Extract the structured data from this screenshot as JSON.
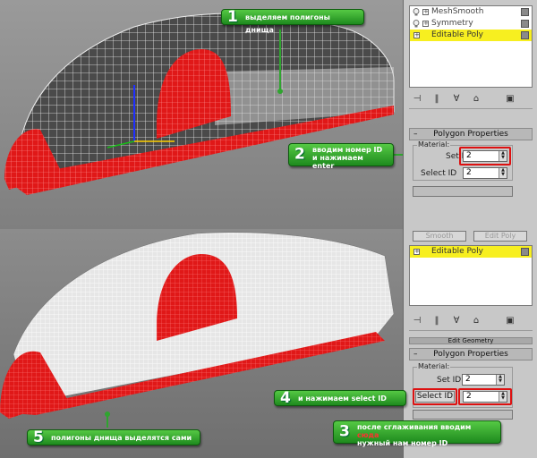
{
  "top": {
    "stack": [
      {
        "label": "MeshSmooth",
        "selected": false
      },
      {
        "label": "Symmetry",
        "selected": false
      },
      {
        "label": "Editable Poly",
        "selected": true
      }
    ],
    "rollout_title": "Polygon Properties",
    "group_label": "Material:",
    "set_id_label": "Set ID:",
    "set_id_value": "2",
    "select_id_label": "Select ID",
    "select_id_value": "2"
  },
  "bottom": {
    "tabs": [
      "Smooth",
      "Edit Poly"
    ],
    "stack": [
      {
        "label": "Editable Poly",
        "selected": true
      }
    ],
    "section_label": "Edit Geometry",
    "rollout_title": "Polygon Properties",
    "group_label": "Material:",
    "set_id_label": "Set ID:",
    "set_id_value": "2",
    "select_id_label": "Select ID",
    "select_id_value": "2"
  },
  "callouts": {
    "c1": {
      "num": "1",
      "text": "выделяем полигоны днища"
    },
    "c2": {
      "num": "2",
      "line1": "вводим номер ID",
      "line2": "и нажимаем enter"
    },
    "c3": {
      "num": "3",
      "line1_a": "после сглаживания вводим ",
      "line1_b": "сюда",
      "line2": "нужный нам номер ID"
    },
    "c4": {
      "num": "4",
      "text": "и нажимаем select ID"
    },
    "c5": {
      "num": "5",
      "text": "полигоны днища выделятся сами"
    }
  },
  "colors": {
    "selection_red": "#e01818",
    "callout_green": "#2fa52f",
    "stack_highlight": "#f7ef20"
  }
}
